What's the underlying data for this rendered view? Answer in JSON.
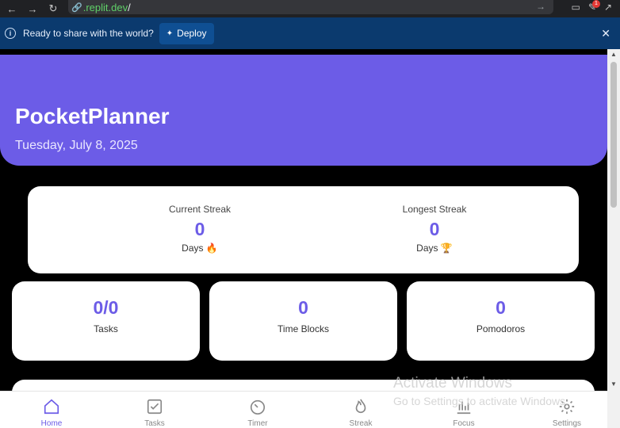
{
  "browser": {
    "url_host": ".replit.dev",
    "url_path": "/"
  },
  "banner": {
    "message": "Ready to share with the world?",
    "deploy_label": "Deploy"
  },
  "header": {
    "title": "PocketPlanner",
    "date": "Tuesday, July 8, 2025"
  },
  "streaks": {
    "current": {
      "label": "Current Streak",
      "value": "0",
      "unit": "Days",
      "emoji": "🔥"
    },
    "longest": {
      "label": "Longest Streak",
      "value": "0",
      "unit": "Days",
      "emoji": "🏆"
    }
  },
  "stats": [
    {
      "value": "0/0",
      "label": "Tasks"
    },
    {
      "value": "0",
      "label": "Time Blocks"
    },
    {
      "value": "0",
      "label": "Pomodoros"
    }
  ],
  "watermark": {
    "title": "Activate Windows",
    "subtitle": "Go to Settings to activate Windows."
  },
  "nav": [
    {
      "label": "Home",
      "icon": "home-icon",
      "active": true
    },
    {
      "label": "Tasks",
      "icon": "checkbox-icon",
      "active": false
    },
    {
      "label": "Timer",
      "icon": "timer-icon",
      "active": false
    },
    {
      "label": "Streak",
      "icon": "flame-icon",
      "active": false
    },
    {
      "label": "Focus",
      "icon": "bar-chart-icon",
      "active": false
    },
    {
      "label": "Settings",
      "icon": "gear-icon",
      "active": false
    }
  ],
  "colors": {
    "accent": "#6c5ce7",
    "banner": "#0b3a6e"
  }
}
